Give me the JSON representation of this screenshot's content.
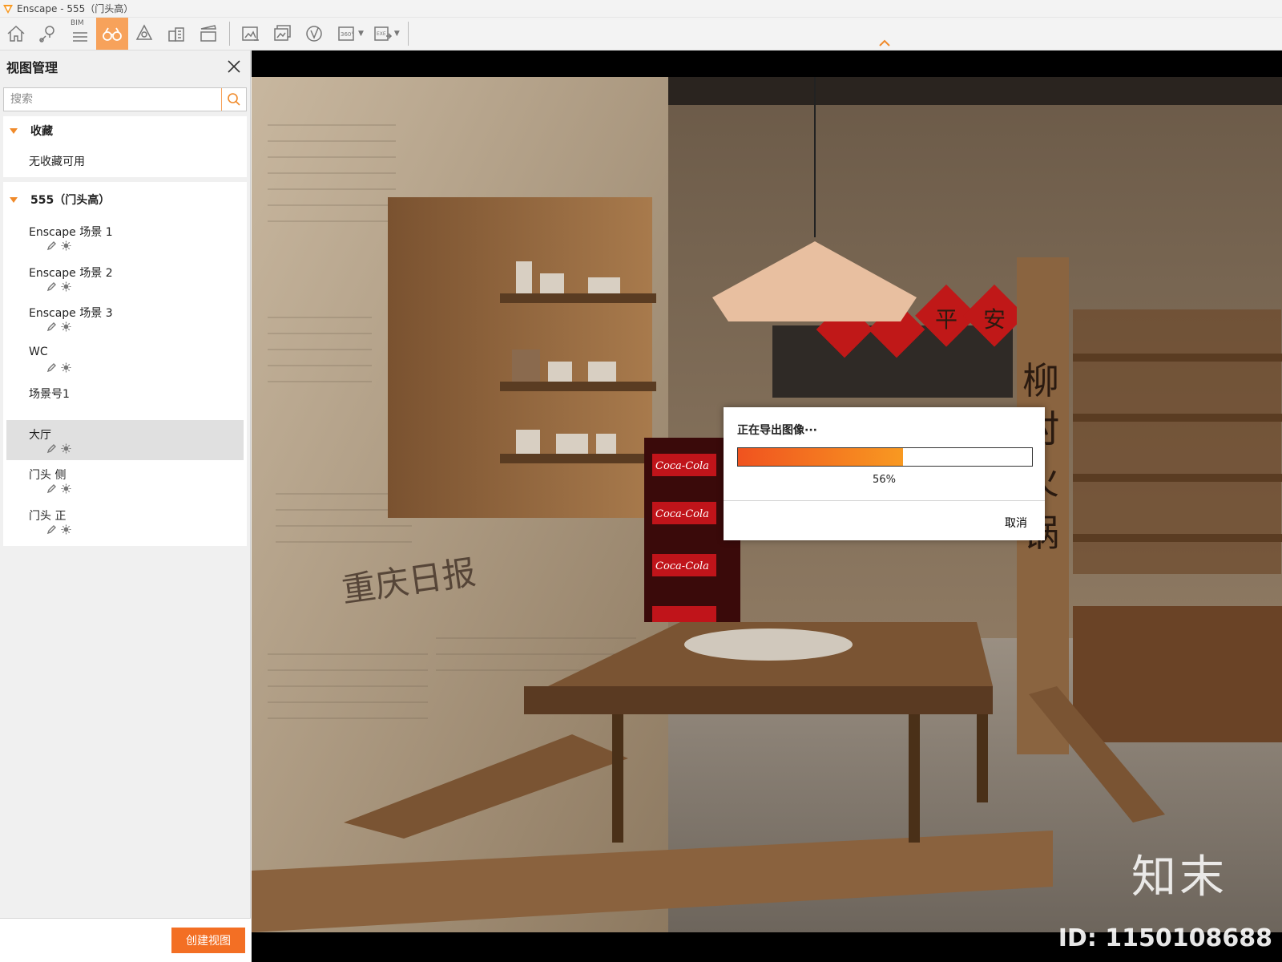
{
  "titlebar": {
    "title": "Enscape - 555（门头高）"
  },
  "toolbar": {
    "bim_label": "BIM",
    "buttons": [
      "home-icon",
      "location-pin-icon",
      "bim-list-icon",
      "binoculars-icon",
      "bell-asset-icon",
      "building-icon",
      "clapperboard-icon",
      "export-image-icon",
      "batch-export-icon",
      "vr-export-icon",
      "panorama-360-icon",
      "export-exe-icon"
    ],
    "active_color": "#f7a25b"
  },
  "sidebar": {
    "title": "视图管理",
    "search_placeholder": "搜索",
    "favorites": {
      "label": "收藏",
      "empty": "无收藏可用"
    },
    "project": {
      "label": "555（门头高）",
      "scenes": [
        {
          "label": "Enscape 场景 1",
          "icons": true
        },
        {
          "label": "Enscape 场景 2",
          "icons": true
        },
        {
          "label": "Enscape 场景 3",
          "icons": true
        },
        {
          "label": "WC",
          "icons": true
        },
        {
          "label": "场景号1",
          "icons": false
        },
        {
          "label": "大厅",
          "icons": true,
          "selected": true
        },
        {
          "label": "门头 侧",
          "icons": true
        },
        {
          "label": "门头 正",
          "icons": true
        }
      ]
    },
    "create_button": "创建视图",
    "accent": "#f36f24"
  },
  "dialog": {
    "title": "正在导出图像···",
    "progress": 0.56,
    "progress_text": "56%",
    "cancel": "取消"
  },
  "viewport": {
    "sign_chars": [
      "柳",
      "村",
      "火",
      "锅"
    ],
    "lantern_chars": [
      "平",
      "安"
    ],
    "newspaper_text": "重庆日报",
    "brand_text": "Coca-Cola",
    "watermark_logo": "知末",
    "watermark_id": "ID: 1150108688"
  }
}
